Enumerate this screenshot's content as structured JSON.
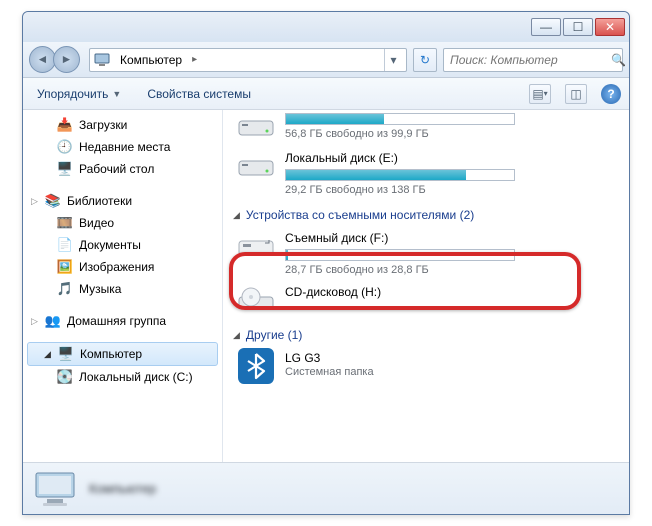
{
  "titlebar": {
    "min": "—",
    "max": "☐",
    "close": "✕"
  },
  "nav": {
    "crumb": "Компьютер",
    "search_placeholder": "Поиск: Компьютер"
  },
  "toolbar": {
    "organize": "Упорядочить",
    "sysprops": "Свойства системы"
  },
  "sidebar": {
    "downloads": "Загрузки",
    "recent": "Недавние места",
    "desktop": "Рабочий стол",
    "libraries": "Библиотеки",
    "video": "Видео",
    "documents": "Документы",
    "pictures": "Изображения",
    "music": "Музыка",
    "homegroup": "Домашняя группа",
    "computer": "Компьютер",
    "localC": "Локальный диск (C:)"
  },
  "main": {
    "drive1_sub": "56,8 ГБ свободно из 99,9 ГБ",
    "drive2_name": "Локальный диск (E:)",
    "drive2_sub": "29,2 ГБ свободно из 138 ГБ",
    "section_removable": "Устройства со съемными носителями (2)",
    "drive3_name": "Съемный диск (F:)",
    "drive3_sub": "28,7 ГБ свободно из 28,8 ГБ",
    "drive4_name": "CD-дисковод (H:)",
    "section_other": "Другие (1)",
    "other1_name": "LG G3",
    "other1_sub": "Системная папка"
  },
  "details": {
    "title": "Компьютер",
    "sub": " "
  }
}
